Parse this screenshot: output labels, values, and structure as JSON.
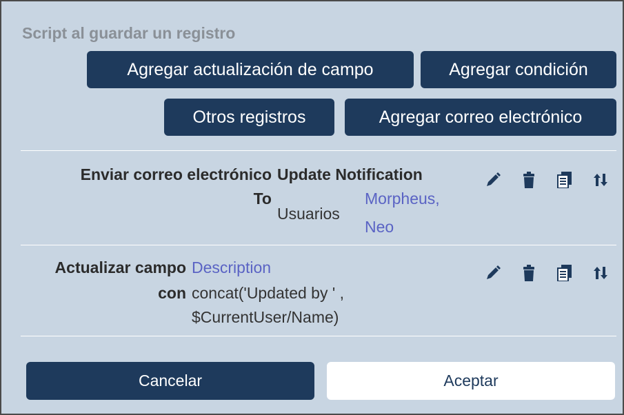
{
  "dialog": {
    "heading": "Script al guardar un registro"
  },
  "toolbar": {
    "add_field_update": "Agregar actualización de campo",
    "add_condition": "Agregar condición",
    "other_records": "Otros registros",
    "add_email": "Agregar correo electrónico"
  },
  "actions": [
    {
      "label": "Enviar correo electrónico",
      "target": "Update Notification",
      "sub_label": "To",
      "sub_kind": "Usuarios",
      "sub_value_line1": "Morpheus,",
      "sub_value_line2": "Neo",
      "icons": [
        "edit-icon",
        "delete-icon",
        "copy-icon",
        "reorder-icon"
      ]
    },
    {
      "label": "Actualizar campo",
      "target": "Description",
      "sub_label": "con",
      "sub_value_line1": "concat('Updated by ' ,",
      "sub_value_line2": "$CurrentUser/Name)",
      "icons": [
        "edit-icon",
        "delete-icon",
        "copy-icon",
        "reorder-icon"
      ]
    }
  ],
  "footer": {
    "cancel": "Cancelar",
    "ok": "Aceptar"
  },
  "colors": {
    "panel_bg": "#c8d5e2",
    "button_bg": "#1e3a5c",
    "link": "#5a63c4",
    "heading": "#8a9097"
  }
}
